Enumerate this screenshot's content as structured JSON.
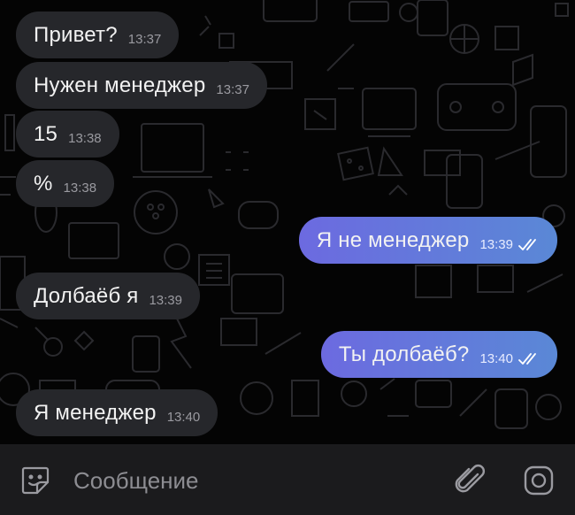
{
  "messages": [
    {
      "direction": "in",
      "text": "Привет?",
      "time": "13:37"
    },
    {
      "direction": "in",
      "text": "Нужен менеджер",
      "time": "13:37"
    },
    {
      "direction": "in",
      "text": "15",
      "time": "13:38"
    },
    {
      "direction": "in",
      "text": "%",
      "time": "13:38"
    },
    {
      "direction": "out",
      "text": "Я не менеджер",
      "time": "13:39",
      "status": "read"
    },
    {
      "direction": "in",
      "text": "Долбаёб я",
      "time": "13:39"
    },
    {
      "direction": "out",
      "text": "Ты долбаёб?",
      "time": "13:40",
      "status": "read"
    },
    {
      "direction": "in",
      "text": "Я менеджер",
      "time": "13:40"
    }
  ],
  "composer": {
    "placeholder": "Сообщение",
    "sticker_icon": "sticker-smile-icon",
    "attach_icon": "paperclip-icon",
    "camera_icon": "camera-icon"
  },
  "colors": {
    "background": "#040404",
    "incoming_bubble": "#26272b",
    "outgoing_gradient_start": "#6c6ae0",
    "outgoing_gradient_end": "#5a88d6",
    "composer_bar": "#1b1b1d"
  }
}
